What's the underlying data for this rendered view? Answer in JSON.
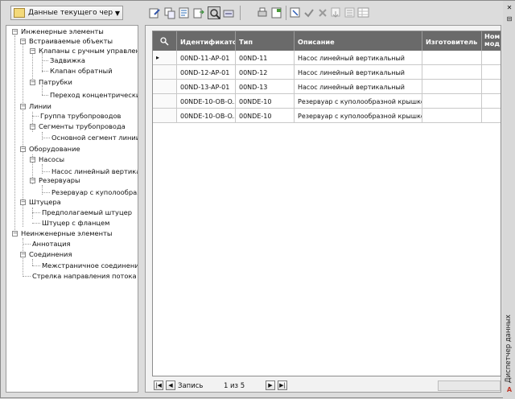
{
  "toolbar": {
    "dropdown_label": "Данные текущего чертеж",
    "buttons": [
      "edit-data-icon",
      "copy-icon",
      "drawing-icon",
      "export-icon",
      "zoom-icon",
      "import-icon",
      "print-icon",
      "report-icon",
      "select-icon",
      "accept-icon",
      "reject-icon",
      "move-down-icon",
      "settings-icon",
      "grid-view-icon"
    ]
  },
  "tree": {
    "nodes": [
      "Инженерные элементы",
      "Встраиваемые объекты",
      "Клапаны с ручным управление",
      "Задвижка",
      "Клапан обратный",
      "Патрубки",
      "Переход концентрический",
      "Линии",
      "Группа трубопроводов",
      "Сегменты трубопровода",
      "Основной сегмент линии",
      "Оборудование",
      "Насосы",
      "Насос линейный вертикальн",
      "Резервуары",
      "Резервуар с куполообразн",
      "Штуцера",
      "Предполагаемый штуцер",
      "Штуцер с фланцем",
      "Неинженерные элементы",
      "Аннотация",
      "Соединения",
      "Межстраничное соединение",
      "Стрелка направления потока"
    ]
  },
  "grid": {
    "columns": [
      "Идентификатор",
      "Тип",
      "Описание",
      "Изготовитель",
      "Ном мод"
    ],
    "rows": [
      [
        "00ND-11-AP-01",
        "00ND-11",
        "Насос линейный вертикальный"
      ],
      [
        "00ND-12-AP-01",
        "00ND-12",
        "Насос линейный вертикальный"
      ],
      [
        "00ND-13-AP-01",
        "00ND-13",
        "Насос линейный вертикальный"
      ],
      [
        "00NDE-10-OB-O...",
        "00NDE-10",
        "Резервуар с куполообразной крышкой"
      ],
      [
        "00NDE-10-OB-O...",
        "00NDE-10",
        "Резервуар с куполообразной крышкой"
      ]
    ],
    "current_row_marker": "▸"
  },
  "navigator": {
    "record_label": "Запись",
    "current": "1",
    "of_label": "из 5"
  },
  "side_panel": {
    "title": "Диспетчер данных"
  }
}
